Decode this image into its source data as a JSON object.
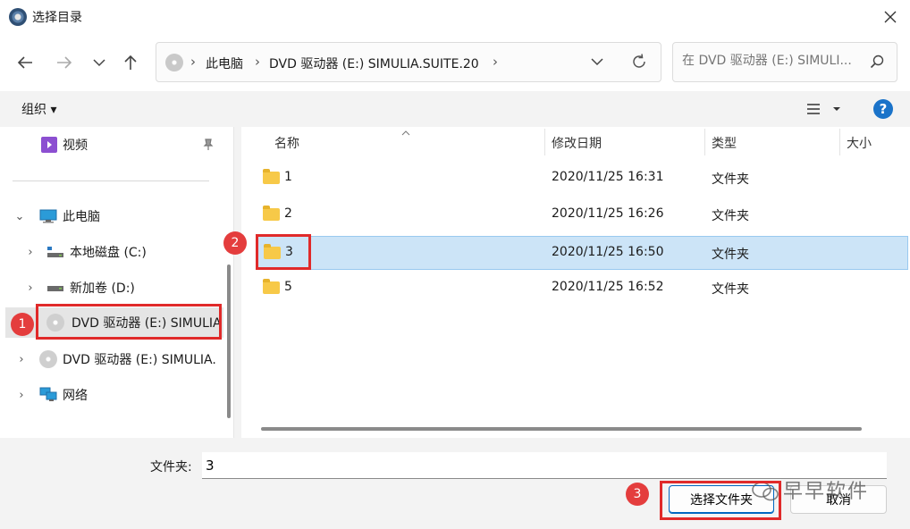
{
  "window": {
    "title": "选择目录"
  },
  "address": {
    "crumbs": [
      "此电脑",
      "DVD 驱动器 (E:) SIMULIA.SUITE.20"
    ]
  },
  "search": {
    "placeholder": "在 DVD 驱动器 (E:) SIMULI..."
  },
  "toolbar": {
    "organize_label": "组织 ▾",
    "help_label": "?"
  },
  "sidebar": {
    "items": [
      {
        "label": "视频"
      },
      {
        "label": "此电脑"
      },
      {
        "label": "本地磁盘 (C:)"
      },
      {
        "label": "新加卷 (D:)"
      },
      {
        "label": "DVD 驱动器 (E:) SIMULIA"
      },
      {
        "label": "DVD 驱动器 (E:) SIMULIA."
      },
      {
        "label": "网络"
      }
    ]
  },
  "columns": {
    "name": "名称",
    "modified": "修改日期",
    "type": "类型",
    "size": "大小"
  },
  "files": [
    {
      "name": "1",
      "modified": "2020/11/25 16:31",
      "type": "文件夹"
    },
    {
      "name": "2",
      "modified": "2020/11/25 16:26",
      "type": "文件夹"
    },
    {
      "name": "3",
      "modified": "2020/11/25 16:50",
      "type": "文件夹"
    },
    {
      "name": "5",
      "modified": "2020/11/25 16:52",
      "type": "文件夹"
    }
  ],
  "footer": {
    "folder_label": "文件夹:",
    "folder_value": "3",
    "select_label": "选择文件夹",
    "cancel_label": "取消"
  },
  "annotations": {
    "step1": "1",
    "step2": "2",
    "step3": "3"
  },
  "watermark": {
    "text": "早早软件"
  },
  "colors": {
    "selection": "#cce4f7",
    "annotation_red": "#e02a2a",
    "accent": "#0067c0"
  }
}
